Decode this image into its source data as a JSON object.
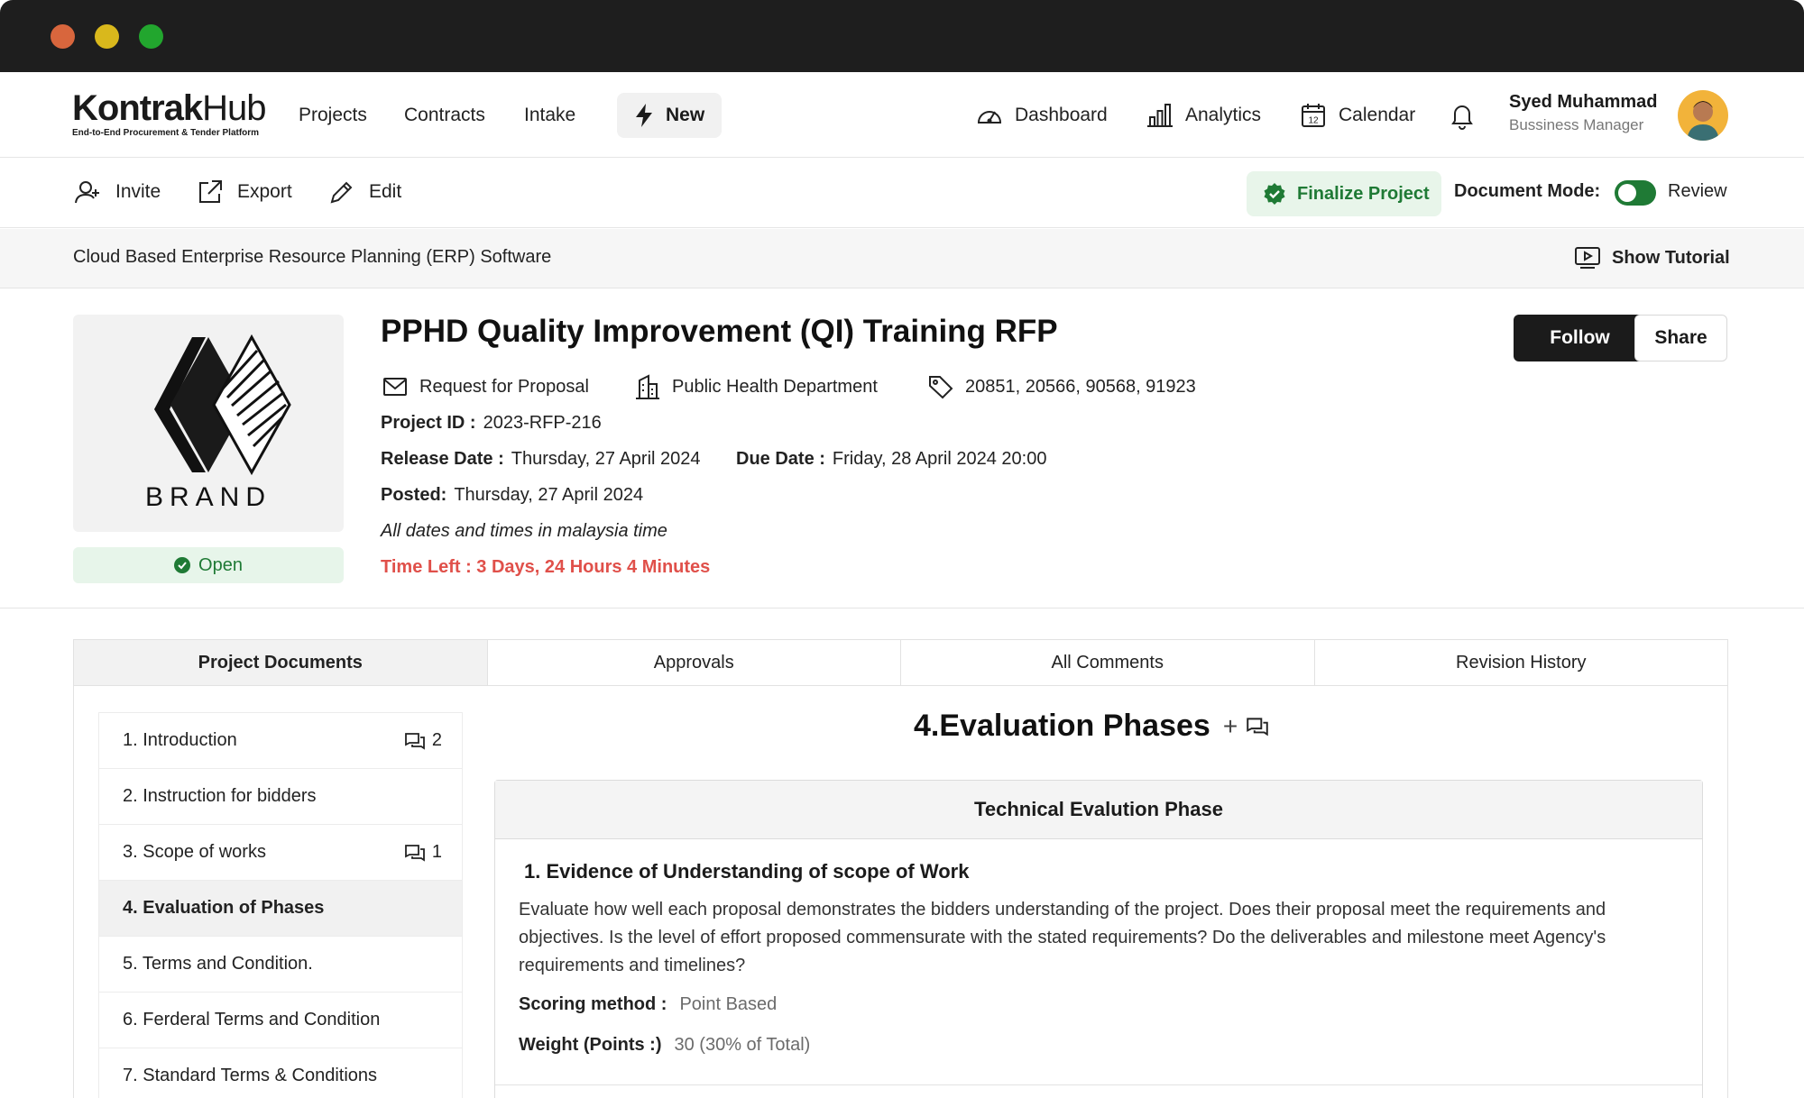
{
  "app": {
    "logo_main": "Kontrak",
    "logo_hub": "Hub",
    "logo_tagline": "End-to-End Procurement & Tender Platform"
  },
  "nav": {
    "links": [
      "Projects",
      "Contracts",
      "Intake"
    ],
    "new_label": "New",
    "dashboard": "Dashboard",
    "analytics": "Analytics",
    "calendar": "Calendar",
    "calendar_day": "12"
  },
  "user": {
    "name": "Syed Muhammad",
    "role": "Bussiness Manager"
  },
  "actions": {
    "invite": "Invite",
    "export": "Export",
    "edit": "Edit",
    "finalize": "Finalize Project",
    "document_mode_label": "Document Mode:",
    "review_label": "Review"
  },
  "breadcrumb": {
    "text": "Cloud Based Enterprise Resource Planning (ERP) Software",
    "tutorial": "Show Tutorial"
  },
  "project": {
    "brand_text": "BRAND",
    "status": "Open",
    "title": "PPHD Quality Improvement (QI) Training RFP",
    "type": "Request for Proposal",
    "department": "Public Health Department",
    "tags": "20851, 20566, 90568, 91923",
    "project_id_label": "Project ID :",
    "project_id": "2023-RFP-216",
    "release_label": "Release Date :",
    "release_date": "Thursday, 27 April 2024",
    "due_label": "Due Date :",
    "due_date": "Friday, 28 April 2024 20:00",
    "posted_label": "Posted:",
    "posted_date": "Thursday, 27 April 2024",
    "timezone_note": "All dates and times in malaysia time",
    "time_left": "Time Left : 3 Days, 24 Hours 4 Minutes",
    "follow": "Follow",
    "share": "Share"
  },
  "tabs": [
    "Project Documents",
    "Approvals",
    "All Comments",
    "Revision History"
  ],
  "documents": [
    {
      "label": "1. Introduction",
      "comments": "2"
    },
    {
      "label": "2. Instruction for bidders",
      "comments": ""
    },
    {
      "label": "3. Scope of works",
      "comments": "1"
    },
    {
      "label": "4. Evaluation of Phases",
      "comments": ""
    },
    {
      "label": "5. Terms and Condition.",
      "comments": ""
    },
    {
      "label": "6. Ferderal Terms and Condition",
      "comments": ""
    },
    {
      "label": "7. Standard Terms & Conditions",
      "comments": ""
    }
  ],
  "content": {
    "section_title": "4.Evaluation Phases",
    "plus": "+",
    "phase_title": "Technical Evalution Phase",
    "criterion_title": "1. Evidence of Understanding of scope of Work",
    "criterion_desc": "Evaluate how well each proposal demonstrates the bidders understanding of the project. Does their proposal meet the requirements and objectives. Is the level of effort proposed commensurate with the stated requirements? Do the deliverables and milestone meet Agency's requirements and timelines?",
    "scoring_label": "Scoring method :",
    "scoring_value": "Point Based",
    "weight_label": "Weight (Points :)",
    "weight_value": "30 (30% of Total)"
  },
  "colors": {
    "accent_green": "#1f7a35",
    "alert_red": "#e0504a",
    "dark": "#1b1b1b"
  }
}
